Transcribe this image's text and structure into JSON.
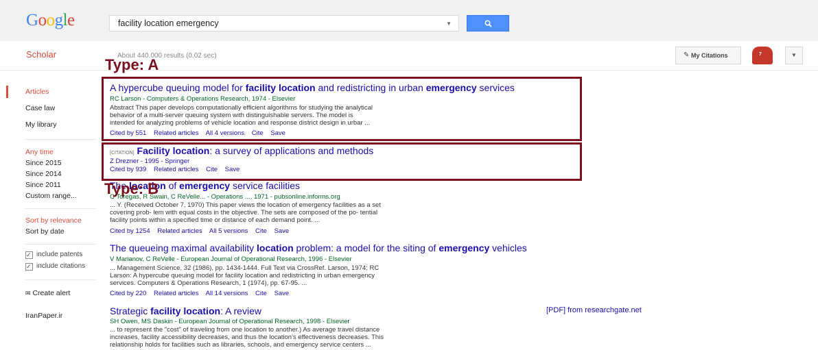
{
  "header": {
    "logo_letters": [
      "G",
      "o",
      "o",
      "g",
      "l",
      "e"
    ],
    "logo_colors": [
      "#4285f4",
      "#ea4335",
      "#fbbc05",
      "#4285f4",
      "#34a853",
      "#ea4335"
    ],
    "search_value": "facility location emergency",
    "scholar_label": "Scholar",
    "results_count": "About 440,000 results (0.02 sec)",
    "my_citations_label": "My Citations",
    "notification_count": "7"
  },
  "sidebar": {
    "doc_types": [
      "Articles",
      "Case law",
      "My library"
    ],
    "time_filters": [
      "Any time",
      "Since 2015",
      "Since 2014",
      "Since 2011",
      "Custom range..."
    ],
    "sort": [
      "Sort by relevance",
      "Sort by date"
    ],
    "checks": [
      "include patents",
      "include citations"
    ],
    "create_alert": "Create alert",
    "iranpaper": "IranPaper.ir"
  },
  "annotations": {
    "type_a": "Type: A",
    "type_b": "Type: B"
  },
  "results": [
    {
      "title_parts": [
        {
          "t": "A hypercube queuing model for ",
          "b": false
        },
        {
          "t": "facility location",
          "b": true
        },
        {
          "t": " and redistricting in urban ",
          "b": false
        },
        {
          "t": "emergency",
          "b": true
        },
        {
          "t": " services",
          "b": false
        }
      ],
      "authors": "RC Larson - Computers & Operations Research, 1974 - Elsevier",
      "snippet": [
        "Abstract This paper develops computationally efficient algorithms for studying the analytical",
        "behavior of a multi-server queuing system with distinguishable servers. The model is",
        "intended for analyzing problems of vehicle location and response district design in urbar ..."
      ],
      "links": [
        "Cited by 551",
        "Related articles",
        "All 4 versions",
        "Cite",
        "Save"
      ]
    },
    {
      "citation_tag": "[CITATION]",
      "title_parts": [
        {
          "t": "Facility location",
          "b": true
        },
        {
          "t": ": a survey of applications and methods",
          "b": false
        }
      ],
      "authors": "Z Drezner - 1995 - Springer",
      "links": [
        "Cited by 939",
        "Related articles",
        "Cite",
        "Save"
      ]
    },
    {
      "title_parts": [
        {
          "t": "The ",
          "b": false
        },
        {
          "t": "location",
          "b": true
        },
        {
          "t": " of ",
          "b": false
        },
        {
          "t": "emergency",
          "b": true
        },
        {
          "t": " service facilities",
          "b": false
        }
      ],
      "authors": "C Toregas, R Swain, C ReVelle... - Operations ..., 1971 - pubsonline.informs.org",
      "snippet": [
        "... Y. (Received October 7, 1970) This paper views the location of emergency facilities as a set",
        "covering prob- lem with equal costs in the objective. The sets are composed of the po- tential",
        "facility points within a specified time or distance of each demand point. ..."
      ],
      "links": [
        "Cited by 1254",
        "Related articles",
        "All 5 versions",
        "Cite",
        "Save"
      ]
    },
    {
      "title_parts": [
        {
          "t": "The queueing maximal availability ",
          "b": false
        },
        {
          "t": "location",
          "b": true
        },
        {
          "t": " problem: a model for the siting of ",
          "b": false
        },
        {
          "t": "emergency",
          "b": true
        },
        {
          "t": " vehicles",
          "b": false
        }
      ],
      "authors": "V Marianov, C ReVelle - European Journal of Operational Research, 1996 - Elsevier",
      "snippet": [
        "... Management Science, 32 (1986), pp. 1434-1444. Full Text via CrossRef. Larson, 1974; RC",
        "Larson: A hypercube queuing model for facility location and redistricting in urban emergency",
        "services. Computers & Operations Research, 1 (1974), pp. 67-95. ..."
      ],
      "links": [
        "Cited by 220",
        "Related articles",
        "All 14 versions",
        "Cite",
        "Save"
      ]
    },
    {
      "title_parts": [
        {
          "t": "Strategic ",
          "b": false
        },
        {
          "t": "facility location",
          "b": true
        },
        {
          "t": ": A review",
          "b": false
        }
      ],
      "authors": "SH Owen, MS Daskin - European Journal of Operational Research, 1998 - Elsevier",
      "snippet": [
        "... to represent the \"cost\" of traveling from one location to another.) As average travel distance",
        "increases, facility accessibility decreases, and thus the location's effectiveness decreases. This",
        "relationship holds for facilities such as libraries, schools, and emergency service centers ..."
      ],
      "pdf": "[PDF] from researchgate.net"
    }
  ]
}
